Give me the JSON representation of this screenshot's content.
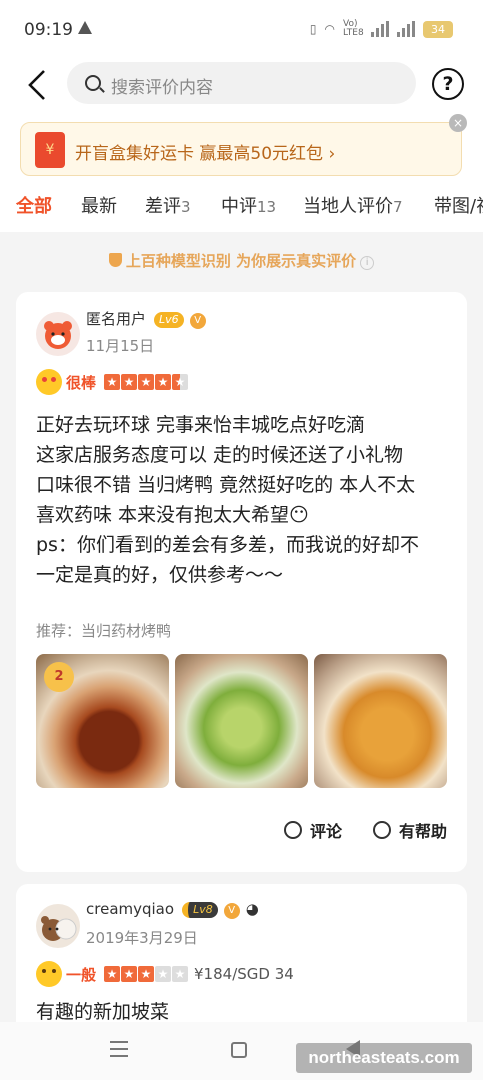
{
  "status_bar": {
    "time": "09:19",
    "battery": "34",
    "net_label": "Vo) LTE8"
  },
  "header": {
    "search_placeholder": "搜索评价内容",
    "help_label": "?"
  },
  "banner": {
    "text": "开盲盒集好运卡 赢最高50元红包 ›",
    "close_label": "×"
  },
  "tabs": [
    {
      "label": "全部",
      "count": ""
    },
    {
      "label": "最新",
      "count": ""
    },
    {
      "label": "差评",
      "count": "3"
    },
    {
      "label": "中评",
      "count": "13"
    },
    {
      "label": "当地人评价",
      "count": "7"
    },
    {
      "label": "带图/视",
      "count": ""
    }
  ],
  "notice": "上百种模型识别 为你展示真实评价",
  "reviews": [
    {
      "user": "匿名用户",
      "level": "Lv6",
      "date": "11月15日",
      "rating_word": "很棒",
      "stars": 4.5,
      "text_lines": [
        "正好去玩环球 完事来怡丰城吃点好吃滴",
        "这家店服务态度可以 走的时候还送了小礼物",
        "口味很不错 当归烤鸭 竟然挺好吃的 本人不太",
        "喜欢药味 本来没有抱太大希望😶",
        "ps：你们看到的差会有多差，而我说的好却不",
        "一定是真的好，仅供参考～～"
      ],
      "recommend": "推荐：当归药材烤鸭",
      "photo_badge": "2",
      "comment_label": "评论",
      "helpful_label": "有帮助"
    },
    {
      "user": "creamyqiao",
      "level": "Lv8",
      "date": "2019年3月29日",
      "rating_word": "一般",
      "stars": 3,
      "price": "¥184/SGD 34",
      "text": "有趣的新加坡菜"
    }
  ],
  "watermark": "northeasteats.com"
}
